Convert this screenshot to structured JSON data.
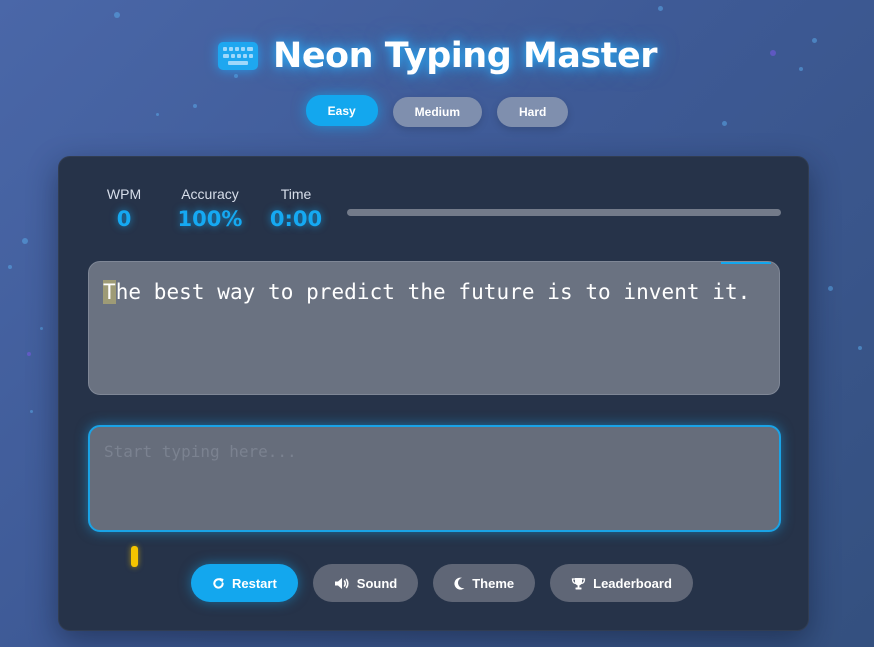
{
  "app": {
    "title": "Neon Typing Master",
    "icon": "keyboard-icon"
  },
  "difficulty": {
    "selected": "Easy",
    "options": [
      {
        "label": "Easy",
        "active": true
      },
      {
        "label": "Medium",
        "active": false
      },
      {
        "label": "Hard",
        "active": false
      }
    ]
  },
  "stats": {
    "wpm_label": "WPM",
    "wpm_value": "0",
    "accuracy_label": "Accuracy",
    "accuracy_value": "100%",
    "time_label": "Time",
    "time_value": "0:00",
    "progress": 0
  },
  "quote": {
    "current_char": "T",
    "rest": "he best way to predict the future is to invent it."
  },
  "input": {
    "placeholder": "Start typing here...",
    "value": ""
  },
  "controls": [
    {
      "label": "Restart",
      "icon": "restart-icon"
    },
    {
      "label": "Sound",
      "icon": "volume-icon"
    },
    {
      "label": "Theme",
      "icon": "moon-icon"
    },
    {
      "label": "Leaderboard",
      "icon": "trophy-icon"
    }
  ],
  "colors": {
    "accent": "#13a7ee",
    "panel": "#263349",
    "caret": "#f5c400"
  }
}
